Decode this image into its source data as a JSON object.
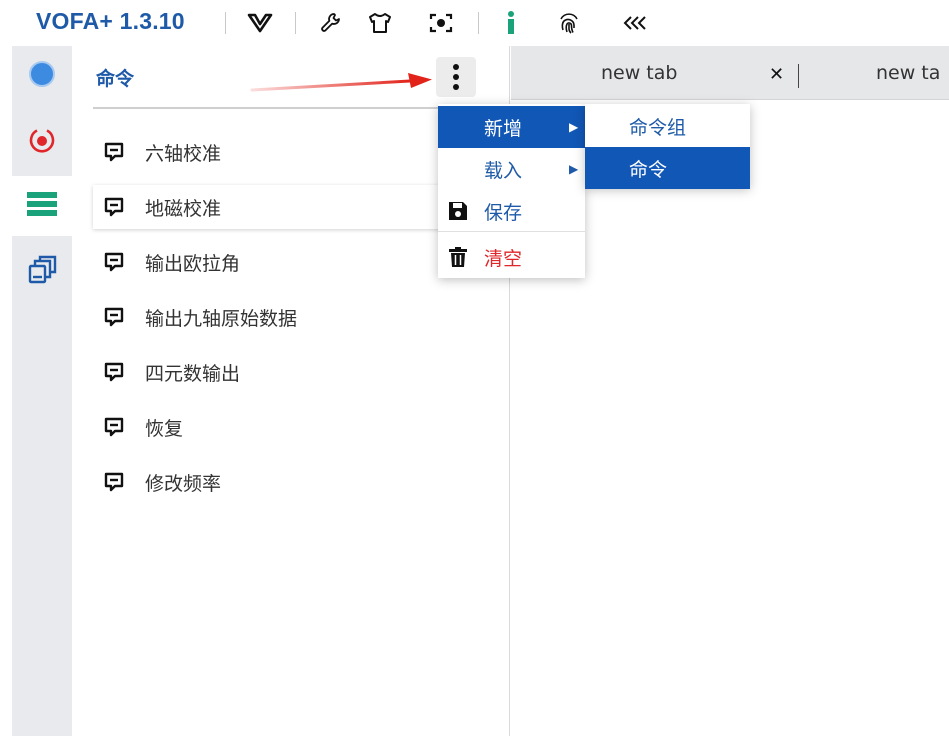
{
  "app": {
    "title": "VOFA+ 1.3.10"
  },
  "toolbar": {
    "icons": [
      "vofa-logo-icon",
      "wrench-icon",
      "shirt-icon",
      "screenshot-icon",
      "info-icon",
      "fingerprint-icon",
      "collapse-chevrons-icon"
    ],
    "info_color": "#1aa37a"
  },
  "rail": {
    "items": [
      "connection-icon",
      "record-icon",
      "command-list-icon",
      "windows-icon"
    ],
    "active_index": 2,
    "colors": {
      "connection": "#3d8be0",
      "record": "#e0262a",
      "commands": "#1aa37a",
      "windows": "#1e5aa8"
    }
  },
  "panel": {
    "title": "命令",
    "commands": [
      {
        "label": "六轴校准"
      },
      {
        "label": "地磁校准"
      },
      {
        "label": "输出欧拉角"
      },
      {
        "label": "输出九轴原始数据"
      },
      {
        "label": "四元数输出"
      },
      {
        "label": "恢复"
      },
      {
        "label": "修改频率"
      }
    ],
    "selected_index": 1
  },
  "tabs": [
    {
      "label": "new tab"
    },
    {
      "label": "new ta"
    }
  ],
  "menu": {
    "items": [
      {
        "label": "新增",
        "has_submenu": true,
        "highlighted": true
      },
      {
        "label": "载入",
        "has_submenu": true,
        "highlighted": false
      },
      {
        "label": "保存",
        "icon": "save-icon"
      },
      {
        "label": "清空",
        "icon": "trash-icon",
        "danger": true
      }
    ]
  },
  "submenu": {
    "items": [
      {
        "label": "命令组",
        "highlighted": false
      },
      {
        "label": "命令",
        "highlighted": true
      }
    ]
  },
  "colors": {
    "accent": "#1e5aa8",
    "highlight": "#1157b6",
    "danger": "#e0262a",
    "annotation_arrow": "#e2231a"
  }
}
